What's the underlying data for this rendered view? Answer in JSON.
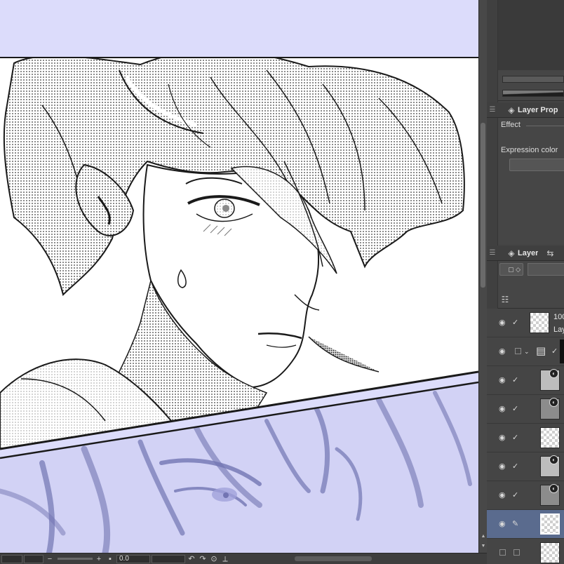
{
  "status_bar": {
    "zoom_value": "",
    "angle_value": "0.0",
    "zoom_out_icon": "minus-icon",
    "zoom_in_icon": "plus-icon",
    "rotate_left_icon": "rotate-left-icon",
    "rotate_right_icon": "rotate-right-icon",
    "reset_icon": "reset-rotation-icon",
    "flip_icon": "flip-icon"
  },
  "layer_property_panel": {
    "tab_label": "Layer Prop",
    "effect_label": "Effect",
    "expression_color_label": "Expression color"
  },
  "layer_panel": {
    "tab_label": "Layer",
    "layers": [
      {
        "line1": "100",
        "line2": "Lay",
        "thumb": "transparent",
        "selected": false
      },
      {
        "line1": "",
        "line2": "",
        "thumb": "folder",
        "selected": false
      },
      {
        "line1": "",
        "line2": "",
        "thumb": "light-gray",
        "selected": false
      },
      {
        "line1": "",
        "line2": "",
        "thumb": "gray",
        "selected": false
      },
      {
        "line1": "",
        "line2": "",
        "thumb": "transparent",
        "selected": false
      },
      {
        "line1": "",
        "line2": "",
        "thumb": "light-gray",
        "selected": false
      },
      {
        "line1": "",
        "line2": "",
        "thumb": "gray",
        "selected": false
      },
      {
        "line1": "",
        "line2": "",
        "thumb": "transparent",
        "selected": true
      },
      {
        "line1": "",
        "line2": "",
        "thumb": "transparent",
        "selected": false
      }
    ]
  },
  "colors": {
    "canvas_background": "#dcdcfb",
    "panel_background": "#454545",
    "selected_layer": "#5a6b8e",
    "sketch_tint": "#6d6fb8"
  }
}
